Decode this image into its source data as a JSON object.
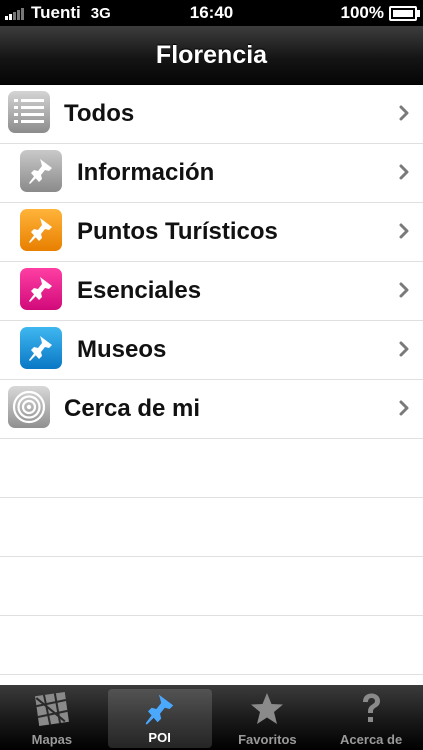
{
  "status_bar": {
    "carrier": "Tuenti",
    "network": "3G",
    "time": "16:40",
    "battery": "100%",
    "battery_level": 1.0
  },
  "nav": {
    "title": "Florencia"
  },
  "list": {
    "items": [
      {
        "label": "Todos",
        "icon": "list-icon",
        "color": "#a8a8a8"
      },
      {
        "label": "Información",
        "icon": "pushpin-icon",
        "color": "#a8a8a8"
      },
      {
        "label": "Puntos Turísticos",
        "icon": "pushpin-icon",
        "color": "#f39a12"
      },
      {
        "label": "Esenciales",
        "icon": "pushpin-icon",
        "color": "#e8258e"
      },
      {
        "label": "Museos",
        "icon": "pushpin-icon",
        "color": "#1e96dc"
      },
      {
        "label": "Cerca de mi",
        "icon": "target-icon",
        "color": "#a8a8a8"
      }
    ]
  },
  "tab_bar": {
    "tabs": [
      {
        "label": "Mapas",
        "icon": "map-icon"
      },
      {
        "label": "POI",
        "icon": "pushpin-icon"
      },
      {
        "label": "Favoritos",
        "icon": "star-icon"
      },
      {
        "label": "Acerca de",
        "icon": "question-icon"
      }
    ],
    "active_tab": "POI"
  },
  "colors": {
    "status_bar": "#000000",
    "nav_bar": "#1a1a1a",
    "tab_active_icon": "#4aa8ff"
  }
}
